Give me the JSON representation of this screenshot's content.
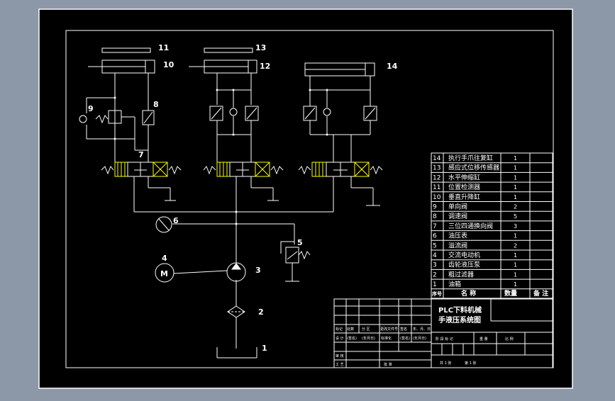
{
  "colors": {
    "background": "#8c97a8",
    "sheet": "#000000",
    "line": "#ffffff",
    "hatch": "#ffff00",
    "text": "#ffffff"
  },
  "callouts": [
    "11",
    "10",
    "13",
    "12",
    "14",
    "9",
    "8",
    "7",
    "6",
    "5",
    "4",
    "3",
    "2",
    "1"
  ],
  "motor_symbol": "M",
  "parts_list": {
    "rows": [
      {
        "no": "14",
        "name": "执行手爪往复缸",
        "qty": "1"
      },
      {
        "no": "13",
        "name": "感应式位移传感器",
        "qty": "1"
      },
      {
        "no": "12",
        "name": "水平伸缩缸",
        "qty": "1"
      },
      {
        "no": "11",
        "name": "位置检测器",
        "qty": "1"
      },
      {
        "no": "10",
        "name": "垂直升降缸",
        "qty": "1"
      },
      {
        "no": "9",
        "name": "单向阀",
        "qty": "2"
      },
      {
        "no": "8",
        "name": "调速阀",
        "qty": "5"
      },
      {
        "no": "7",
        "name": "三位四通换向阀",
        "qty": "3"
      },
      {
        "no": "6",
        "name": "油压表",
        "qty": "1"
      },
      {
        "no": "5",
        "name": "溢流阀",
        "qty": "2"
      },
      {
        "no": "4",
        "name": "交流电动机",
        "qty": "1"
      },
      {
        "no": "3",
        "name": "齿轮液压泵",
        "qty": "1"
      },
      {
        "no": "2",
        "name": "粗过滤器",
        "qty": "1"
      },
      {
        "no": "1",
        "name": "油箱",
        "qty": "1"
      }
    ],
    "header": {
      "no": "序号",
      "name": "名  称",
      "qty": "数量",
      "remark": "备 注"
    }
  },
  "title_block": {
    "title_line1": "PLC下料机械",
    "title_line2": "手液压系统图",
    "row_labels": [
      "标记",
      "处数",
      "分 区",
      "更改文件号",
      "签名",
      "年、月、日"
    ],
    "design_row": [
      "设 计",
      "(签名)",
      "(年月日)",
      "标准化",
      "(签名)",
      "(年月日)"
    ],
    "stage_labels": [
      "阶 段 标 记",
      "重 量",
      "比 例"
    ],
    "review_labels": [
      "审 核",
      "工 艺",
      "批 准"
    ],
    "sheet_info": [
      "共 1 张",
      "第 1 张"
    ]
  }
}
